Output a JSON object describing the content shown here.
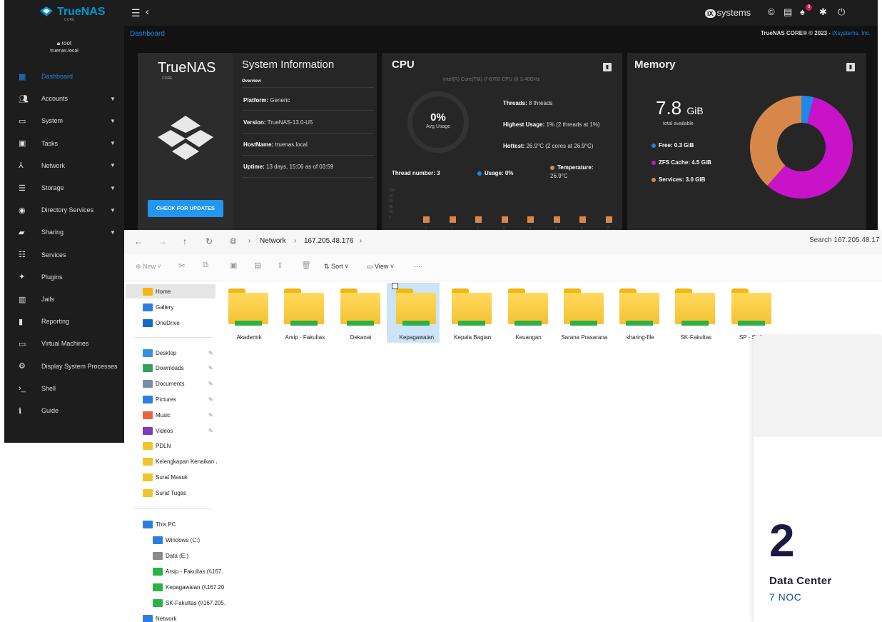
{
  "truenas": {
    "brand": "TrueNAS",
    "brand_tag": "CORE",
    "vendor": "systems",
    "vendor_mark": "iX",
    "notification_count": "9",
    "breadcrumb": "Dashboard",
    "copyright_main": "TrueNAS CORE® © 2023 - ",
    "copyright_link": "iXsystems, Inc.",
    "user_icon": "lock-icon",
    "user_name": "root",
    "user_host": "truenas.local",
    "nav": [
      {
        "label": "Dashboard",
        "icon": "dashboard-icon",
        "has_chevron": false
      },
      {
        "label": "Accounts",
        "icon": "accounts-icon",
        "has_chevron": true
      },
      {
        "label": "System",
        "icon": "system-icon",
        "has_chevron": true
      },
      {
        "label": "Tasks",
        "icon": "tasks-icon",
        "has_chevron": true
      },
      {
        "label": "Network",
        "icon": "network-icon",
        "has_chevron": true
      },
      {
        "label": "Storage",
        "icon": "storage-icon",
        "has_chevron": true
      },
      {
        "label": "Directory Services",
        "icon": "directory-icon",
        "has_chevron": true
      },
      {
        "label": "Sharing",
        "icon": "sharing-icon",
        "has_chevron": true
      },
      {
        "label": "Services",
        "icon": "services-icon",
        "has_chevron": false
      },
      {
        "label": "Plugins",
        "icon": "plugins-icon",
        "has_chevron": false
      },
      {
        "label": "Jails",
        "icon": "jails-icon",
        "has_chevron": false
      },
      {
        "label": "Reporting",
        "icon": "reporting-icon",
        "has_chevron": false
      },
      {
        "label": "Virtual Machines",
        "icon": "vm-icon",
        "has_chevron": false
      },
      {
        "label": "Display System Processes",
        "icon": "processes-icon",
        "has_chevron": false
      },
      {
        "label": "Shell",
        "icon": "shell-icon",
        "has_chevron": false
      },
      {
        "label": "Guide",
        "icon": "guide-icon",
        "has_chevron": false
      }
    ],
    "sysinfo": {
      "logo_text": "TrueNAS",
      "logo_tag": "CORE",
      "title": "System Information",
      "overview": "Overview",
      "platform_label": "Platform:",
      "platform": "Generic",
      "version_label": "Version:",
      "version": "TrueNAS-13.0-U5",
      "host_label": "HostName:",
      "host": "truenas.local",
      "uptime_label": "Uptime:",
      "uptime": "13 days, 15:06 as of 03:59",
      "update_button": "CHECK FOR UPDATES"
    },
    "cpu": {
      "title": "CPU",
      "model": "Intel(R) Core(TM) i7-6700 CPU @ 3.40GHz",
      "usage_value": "0%",
      "usage_label": "Avg Usage",
      "threads_label": "Threads:",
      "threads": "8 threads",
      "highest_label": "Highest Usage:",
      "highest": "1%  (2 threads at 1%)",
      "hottest_label": "Hottest:",
      "hottest": "26.9°C  (2 cores at 26.9°C)",
      "thread_number_label": "Thread number:",
      "thread_number": "3",
      "usage_legend": "Usage: 0%",
      "temp_legend": "Temperature:",
      "temp_value": "26.9°C"
    },
    "memory": {
      "title": "Memory",
      "total": "7.8",
      "unit": "GiB",
      "total_label": "total available",
      "free": "Free: 0.3 GiB",
      "zfs": "ZFS Cache: 4.5 GiB",
      "services": "Services: 3.0 GiB",
      "colors": {
        "free": "#1e88e5",
        "zfs": "#c813c8",
        "services": "#d8874b"
      }
    }
  },
  "chart_data": [
    {
      "type": "bar",
      "categories": [
        "0",
        "1",
        "2",
        "3",
        "4",
        "5",
        "6",
        "7"
      ],
      "y_ticks": [
        "100",
        "80",
        "60",
        "40",
        "20",
        "0"
      ],
      "series": [
        {
          "name": "Usage",
          "values": [
            0,
            0,
            0,
            0,
            0,
            0,
            0,
            0
          ],
          "color": "#1e88e5"
        },
        {
          "name": "Temperature",
          "values": [
            26.9,
            26.9,
            26.9,
            26.9,
            26.9,
            26.9,
            26.9,
            26.9
          ],
          "color": "#d8874b"
        }
      ],
      "ylim": [
        0,
        100
      ]
    },
    {
      "type": "pie",
      "categories": [
        "Free",
        "ZFS Cache",
        "Services"
      ],
      "values": [
        0.3,
        4.5,
        3.0
      ],
      "unit": "GiB",
      "colors": [
        "#1e88e5",
        "#c813c8",
        "#d8874b"
      ]
    }
  ],
  "explorer": {
    "address": [
      "Network",
      "167.205.48.176"
    ],
    "search_placeholder": "Search 167.205.48.17",
    "toolbar": {
      "new": "New",
      "sort": "Sort",
      "view": "View",
      "more": "···"
    },
    "nav_top": [
      {
        "label": "Home",
        "color": "#f2b712"
      },
      {
        "label": "Gallery",
        "color": "#2f7de1"
      },
      {
        "label": "OneDrive",
        "color": "#1669c2"
      }
    ],
    "quick": [
      {
        "label": "Desktop",
        "color": "#3b8fe0",
        "pinned": true
      },
      {
        "label": "Downloads",
        "color": "#2fa35b",
        "pinned": true
      },
      {
        "label": "Documents",
        "color": "#7a8ea8",
        "pinned": true
      },
      {
        "label": "Pictures",
        "color": "#2f7de1",
        "pinned": true
      },
      {
        "label": "Music",
        "color": "#e9643c",
        "pinned": true
      },
      {
        "label": "Videos",
        "color": "#7b3fb8",
        "pinned": true
      },
      {
        "label": "PDLN",
        "color": "#f2c233",
        "pinned": false
      },
      {
        "label": "Kelengkapan Kenaikan J",
        "color": "#f2c233",
        "pinned": false
      },
      {
        "label": "Surat Masuk",
        "color": "#f2c233",
        "pinned": false
      },
      {
        "label": "Surat Tugas",
        "color": "#f2c233",
        "pinned": false
      }
    ],
    "thispc": [
      {
        "label": "This PC",
        "color": "#2f7de1"
      },
      {
        "label": "Windows (C:)",
        "color": "#2f7de1"
      },
      {
        "label": "Data (E:)",
        "color": "#8a8a8a"
      },
      {
        "label": "Arsip - Fakultas (\\\\167.",
        "color": "#2fb045"
      },
      {
        "label": "Kepagawaian (\\\\167.20",
        "color": "#2fb045"
      },
      {
        "label": "SK-Fakultas (\\\\167.205.",
        "color": "#2fb045"
      },
      {
        "label": "Network",
        "color": "#2f7de1"
      }
    ],
    "folders": [
      "Akademik",
      "Arsip - Fakultas",
      "Dekanat",
      "Kepagawaian",
      "Kepala Bagian",
      "Keuangan",
      "Sarana Prasarana",
      "sharing-file",
      "SK-Fakultas",
      "SP - Sisfo"
    ],
    "selected_folder": "Kepagawaian"
  },
  "datacenter": {
    "number": "2",
    "title": "Data Center",
    "subtitle": "7 NOC"
  }
}
